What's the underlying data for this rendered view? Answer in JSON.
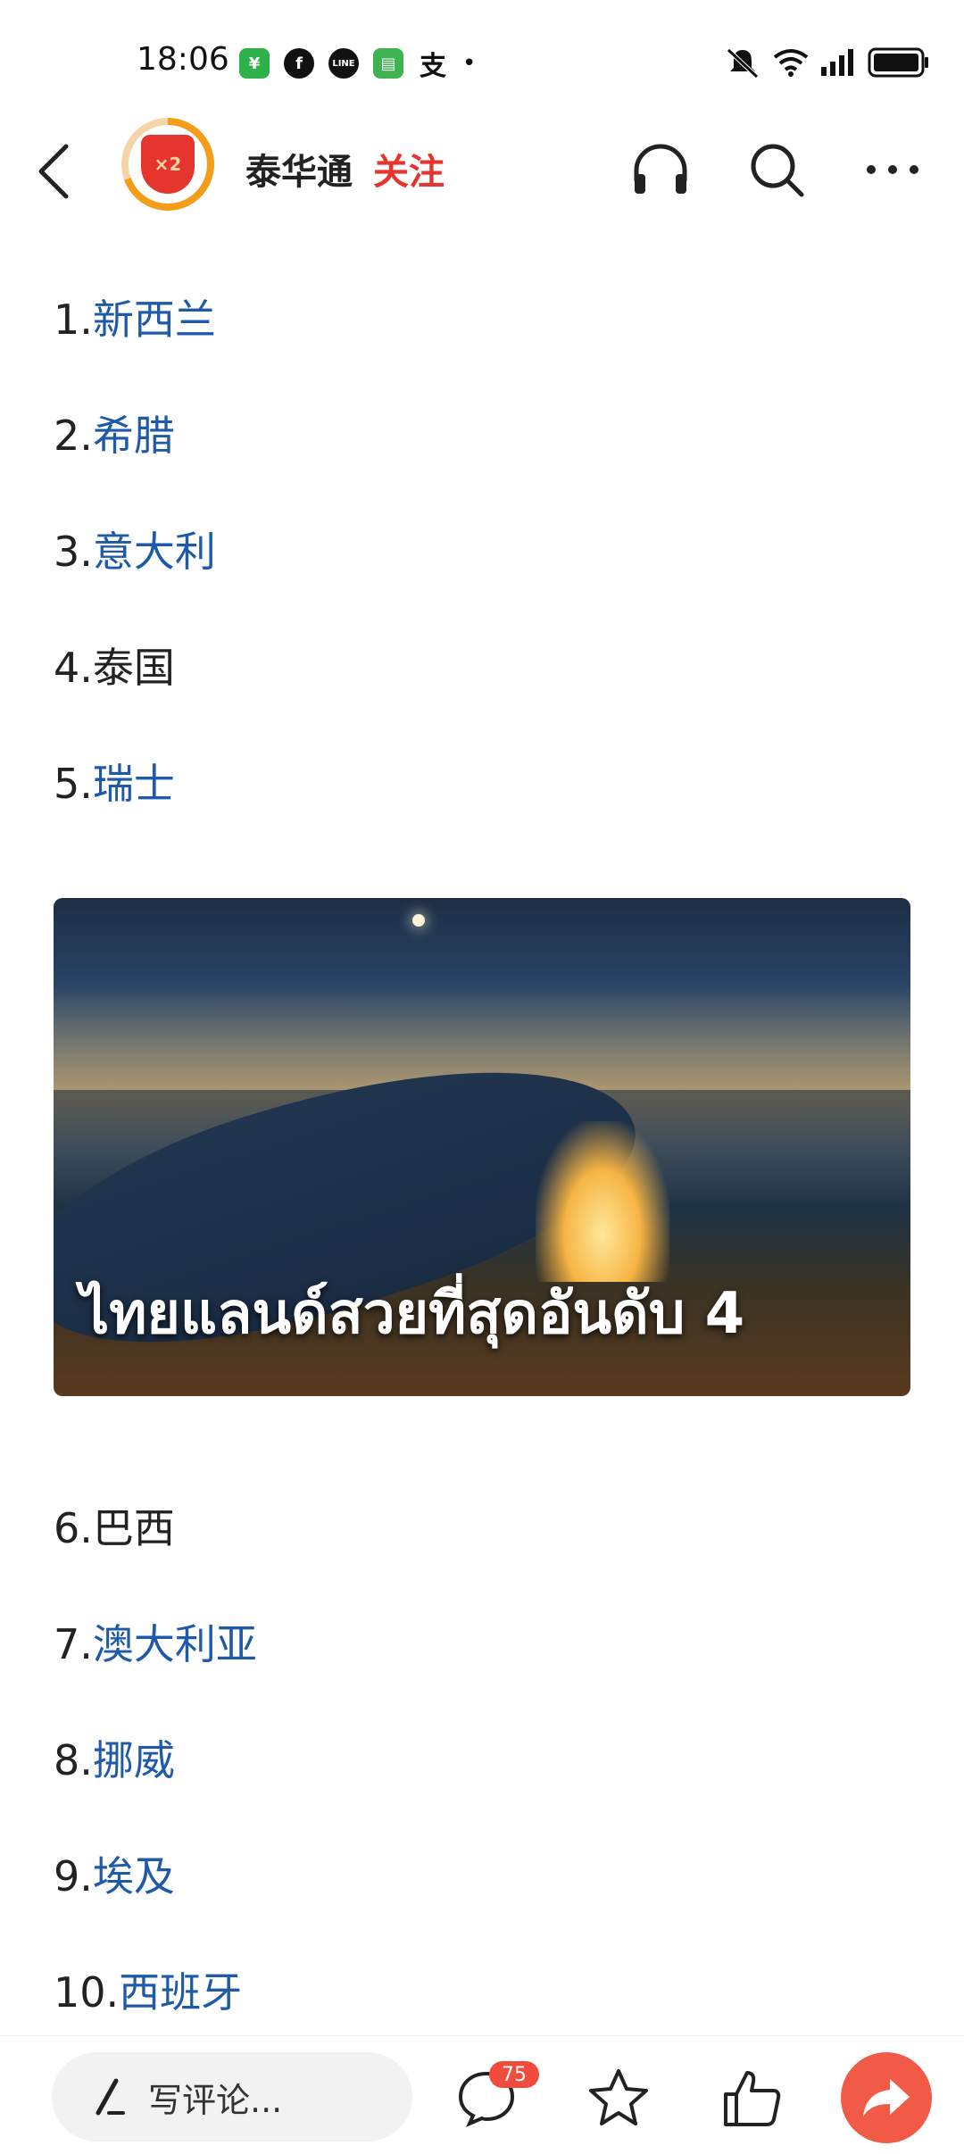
{
  "status_bar": {
    "time": "18:06",
    "notification_icons": [
      "wechat-pay-icon",
      "facebook-icon",
      "line-icon",
      "messages-icon",
      "alipay-icon"
    ],
    "more_dot": "•",
    "right_icons": [
      "mute-icon",
      "wifi-icon",
      "signal-icon",
      "battery-icon"
    ]
  },
  "header": {
    "account_name": "泰华通",
    "follow_label": "关注",
    "avatar_badge": "×2",
    "icons": [
      "back-icon",
      "headphones-icon",
      "search-icon",
      "more-icon"
    ]
  },
  "list": {
    "items": [
      {
        "num": "1.",
        "name": "新西兰",
        "link": true
      },
      {
        "num": "2.",
        "name": "希腊",
        "link": true
      },
      {
        "num": "3.",
        "name": "意大利",
        "link": true
      },
      {
        "num": "4.",
        "name": "泰国",
        "link": false
      },
      {
        "num": "5.",
        "name": "瑞士",
        "link": true
      },
      {
        "num": "6.",
        "name": "巴西",
        "link": false
      },
      {
        "num": "7.",
        "name": "澳大利亚",
        "link": true
      },
      {
        "num": "8.",
        "name": "挪威",
        "link": true
      },
      {
        "num": "9.",
        "name": "埃及",
        "link": true
      },
      {
        "num": "10.",
        "name": "西班牙",
        "link": true
      }
    ]
  },
  "photo": {
    "caption": "ไทยแลนด์สวยที่สุดอันดับ 4"
  },
  "bottom_bar": {
    "comment_placeholder": "写评论...",
    "comment_count": "75"
  },
  "colors": {
    "link": "#1e5aa8",
    "follow": "#e6352f",
    "share": "#f25a48"
  }
}
